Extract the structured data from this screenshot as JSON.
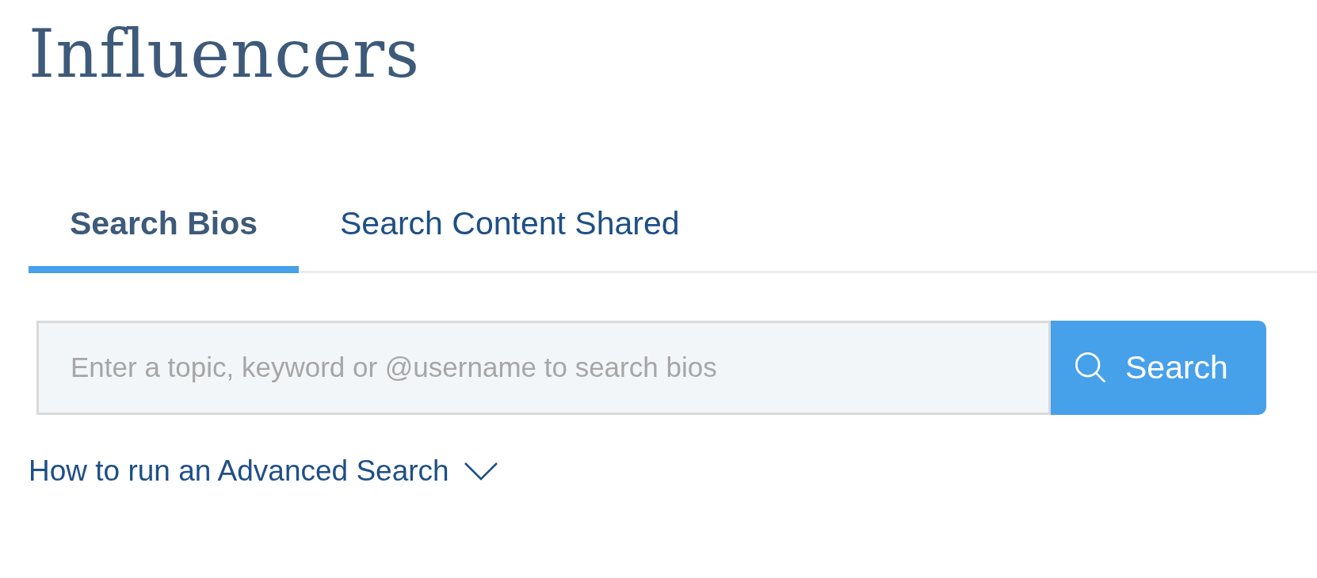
{
  "page": {
    "title": "Influencers"
  },
  "tabs": [
    {
      "label": "Search Bios",
      "selected": true
    },
    {
      "label": "Search Content Shared",
      "selected": false
    }
  ],
  "search": {
    "placeholder": "Enter a topic, keyword or @username to search bios",
    "button": "Search"
  },
  "advanced_link": {
    "label": "How to run an Advanced Search",
    "expanded": false
  }
}
